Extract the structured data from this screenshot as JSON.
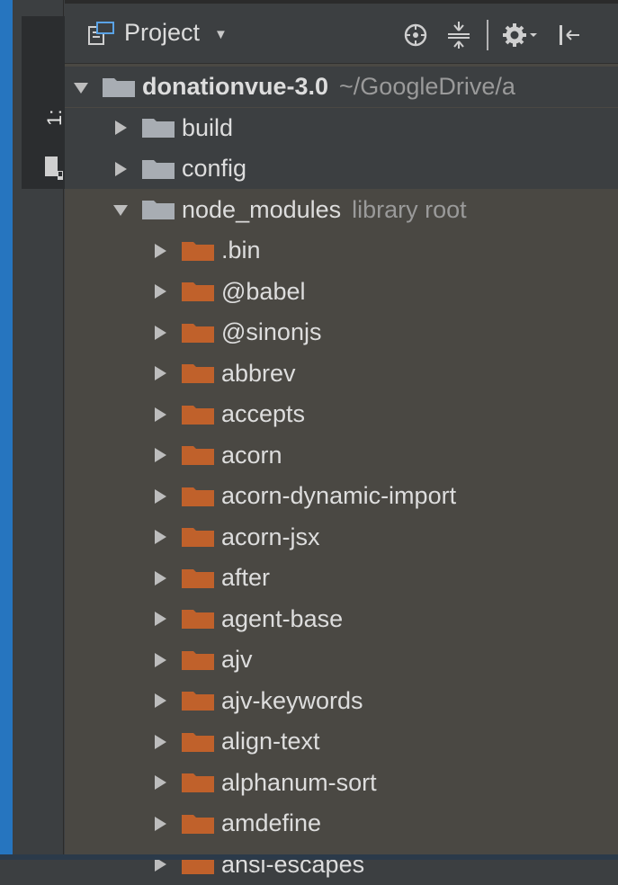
{
  "tool_window": {
    "tab_label": "1: Project"
  },
  "header": {
    "title": "Project",
    "icons": [
      "locate-icon",
      "collapse-all-icon",
      "settings-icon",
      "hide-panel-icon"
    ]
  },
  "colors": {
    "library_folder": "#c0612b",
    "plain_folder": "#a8adb3",
    "panel_bg": "#4a4843",
    "header_bg": "#3c3f41"
  },
  "tree": {
    "root": {
      "name": "donationvue-3.0",
      "path": "~/GoogleDrive/a"
    },
    "build": {
      "name": "build"
    },
    "config": {
      "name": "config"
    },
    "node_modules": {
      "name": "node_modules",
      "hint": "library root"
    },
    "children": [
      ".bin",
      "@babel",
      "@sinonjs",
      "abbrev",
      "accepts",
      "acorn",
      "acorn-dynamic-import",
      "acorn-jsx",
      "after",
      "agent-base",
      "ajv",
      "ajv-keywords",
      "align-text",
      "alphanum-sort",
      "amdefine",
      "ansi-escapes"
    ]
  }
}
